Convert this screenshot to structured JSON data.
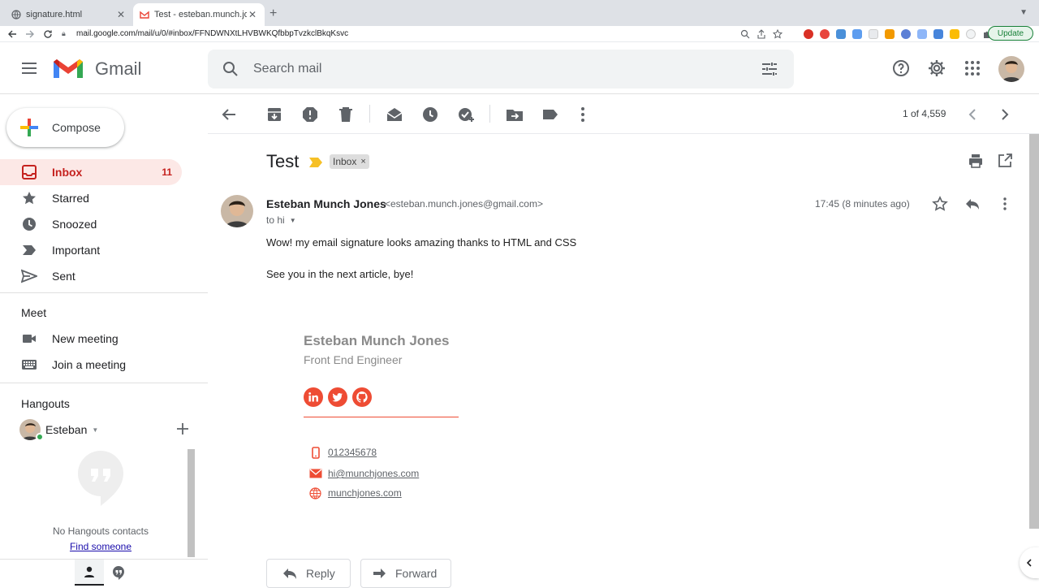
{
  "browser": {
    "tabs": [
      {
        "title": "signature.html",
        "close": "✕"
      },
      {
        "title": "Test - esteban.munch.jones@gmail.com",
        "close": "✕"
      }
    ],
    "new_tab": "+",
    "url": "mail.google.com/mail/u/0/#inbox/FFNDWNXtLHVBWKQfbbpTvzkclBkqKsvc",
    "update_label": "Update"
  },
  "header": {
    "brand": "Gmail",
    "search_placeholder": "Search mail"
  },
  "sidebar": {
    "compose_label": "Compose",
    "items": [
      {
        "label": "Inbox",
        "count": "11",
        "icon": "inbox-icon"
      },
      {
        "label": "Starred",
        "count": "",
        "icon": "star-icon"
      },
      {
        "label": "Snoozed",
        "count": "",
        "icon": "clock-icon"
      },
      {
        "label": "Important",
        "count": "",
        "icon": "important-icon"
      },
      {
        "label": "Sent",
        "count": "",
        "icon": "send-icon"
      }
    ],
    "meet": {
      "title": "Meet",
      "items": [
        {
          "label": "New meeting",
          "icon": "video-camera-icon"
        },
        {
          "label": "Join a meeting",
          "icon": "keyboard-icon"
        }
      ]
    },
    "hangouts": {
      "title": "Hangouts",
      "user": "Esteban",
      "empty_text": "No Hangouts contacts",
      "find_link": "Find someone"
    }
  },
  "toolbar": {
    "pager": "1 of 4,559"
  },
  "message": {
    "subject": "Test",
    "label": "Inbox",
    "label_close": "×",
    "sender_name": "Esteban Munch Jones",
    "sender_email": "<esteban.munch.jones@gmail.com>",
    "to": "to hi",
    "timestamp": "17:45 (8 minutes ago)",
    "body": [
      "Wow! my email signature looks amazing thanks to HTML and CSS",
      "See you in the next article, bye!"
    ],
    "signature": {
      "name": "Esteban Munch Jones",
      "title": "Front End Engineer",
      "social": [
        "linkedin-icon",
        "twitter-icon",
        "github-icon"
      ],
      "phone": "012345678",
      "email": "hi@munchjones.com",
      "website": "munchjones.com"
    }
  },
  "actions": {
    "reply": "Reply",
    "forward": "Forward"
  },
  "colors": {
    "gmail_red": "#ea4335",
    "inbox_active_bg": "#fce8e6",
    "signature_accent": "#ee4c34",
    "signature_text": "#8a8a8a"
  }
}
